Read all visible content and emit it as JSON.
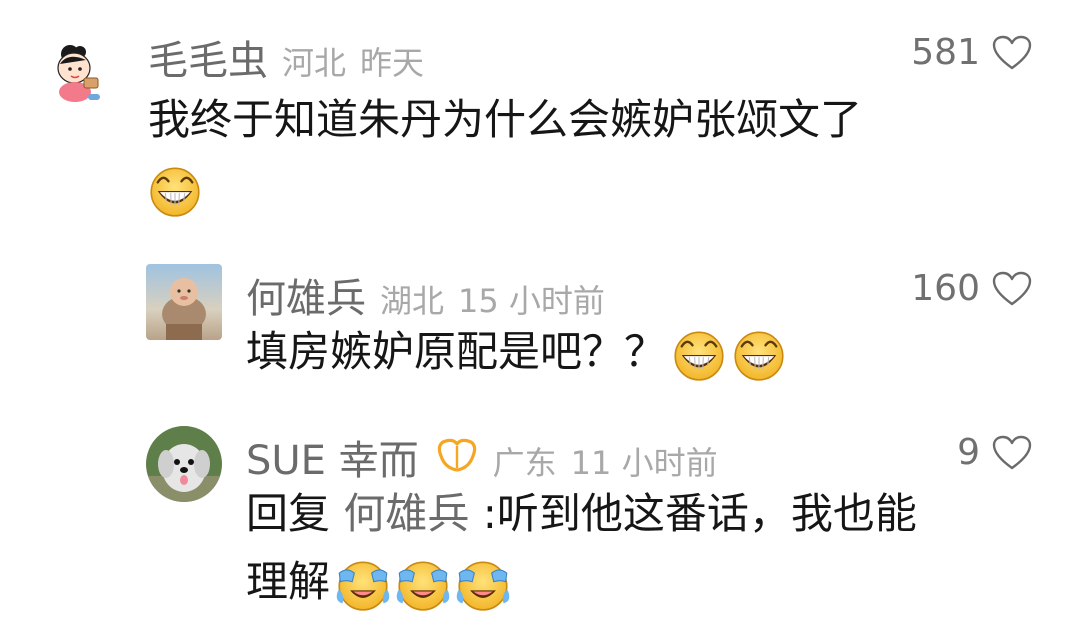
{
  "comments": [
    {
      "username": "毛毛虫",
      "location": "河北",
      "time": "昨天",
      "likes": "581",
      "avatar": "cartoon-girl-avatar",
      "text": "我终于知道朱丹为什么会嫉妒张颂文了",
      "emojis": [
        "grinning-face-emoji"
      ]
    },
    {
      "username": "何雄兵",
      "location": "湖北",
      "time": "15 小时前",
      "likes": "160",
      "avatar": "chubby-baby-photo-avatar",
      "text": "填房嫉妒原配是吧？？",
      "emojis": [
        "grinning-face-emoji",
        "grinning-face-emoji"
      ]
    },
    {
      "username": "SUE 幸而",
      "badge": "orange-butterfly-badge-icon",
      "location": "广东",
      "time": "11 小时前",
      "likes": "9",
      "avatar": "dog-photo-avatar",
      "reply_prefix": "回复",
      "reply_to": "何雄兵",
      "text_line1": ":听到他这番话，我也能",
      "text_line2": "理解",
      "emojis": [
        "crying-face-emoji",
        "crying-face-emoji",
        "crying-face-emoji"
      ]
    }
  ],
  "colors": {
    "username": "#6b6b6b",
    "meta": "#a8a8a8",
    "text": "#161616",
    "emoji_yellow": "#f7c43a",
    "badge_orange": "#f5a623"
  }
}
